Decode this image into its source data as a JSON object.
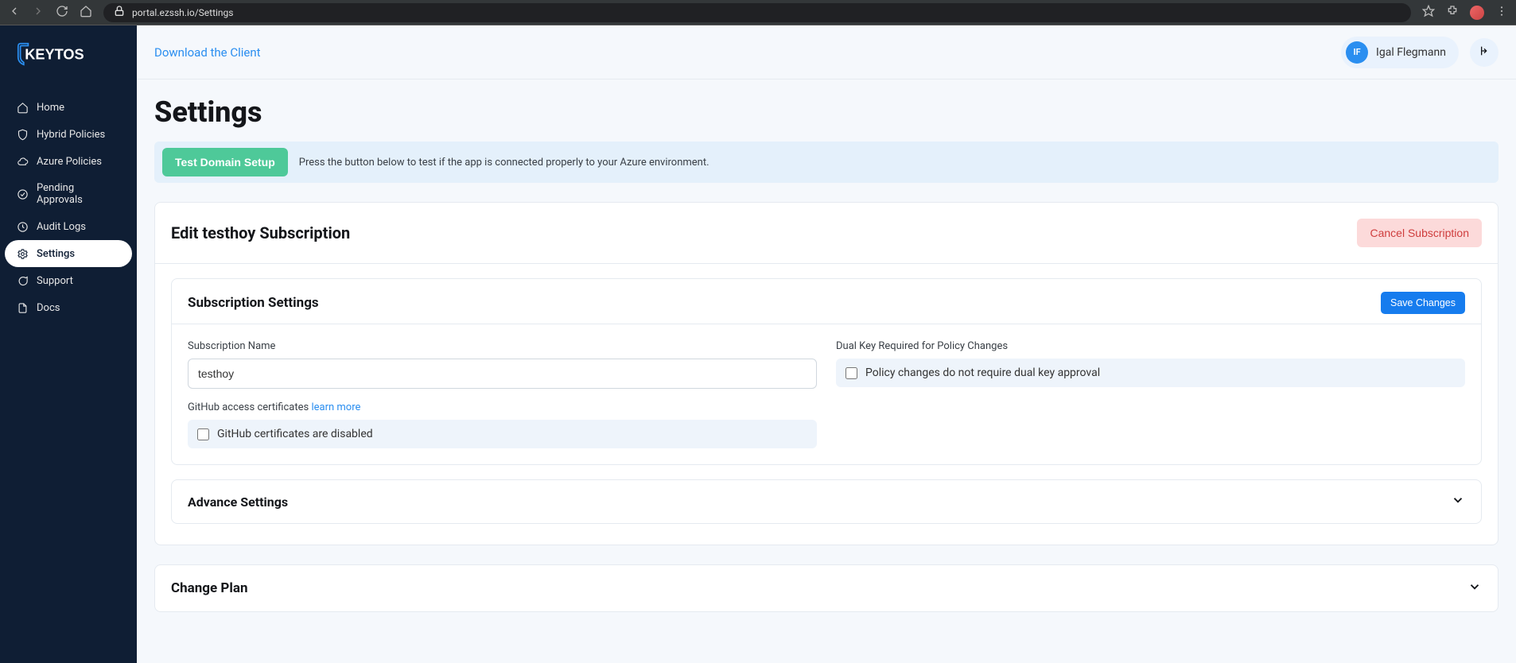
{
  "browser": {
    "url": "portal.ezssh.io/Settings"
  },
  "brand": "KEYTOS",
  "sidebar": {
    "items": [
      {
        "label": "Home"
      },
      {
        "label": "Hybrid Policies"
      },
      {
        "label": "Azure Policies"
      },
      {
        "label": "Pending Approvals"
      },
      {
        "label": "Audit Logs"
      },
      {
        "label": "Settings"
      },
      {
        "label": "Support"
      },
      {
        "label": "Docs"
      }
    ]
  },
  "topbar": {
    "download_link": "Download the Client",
    "user_initials": "IF",
    "user_name": "Igal Flegmann"
  },
  "page": {
    "title": "Settings",
    "alert_button": "Test Domain Setup",
    "alert_text": "Press the button below to test if the app is connected properly to your Azure environment.",
    "edit_title": "Edit testhoy Subscription",
    "cancel_label": "Cancel Subscription",
    "panel_title": "Subscription Settings",
    "save_label": "Save Changes",
    "sub_name_label": "Subscription Name",
    "sub_name_value": "testhoy",
    "github_label_prefix": "GitHub access certificates ",
    "github_learn_more": "learn more",
    "github_checkbox_label": "GitHub certificates are disabled",
    "dualkey_label": "Dual Key Required for Policy Changes",
    "dualkey_checkbox_label": "Policy changes do not require dual key approval",
    "advance_title": "Advance Settings",
    "change_plan_title": "Change Plan"
  }
}
